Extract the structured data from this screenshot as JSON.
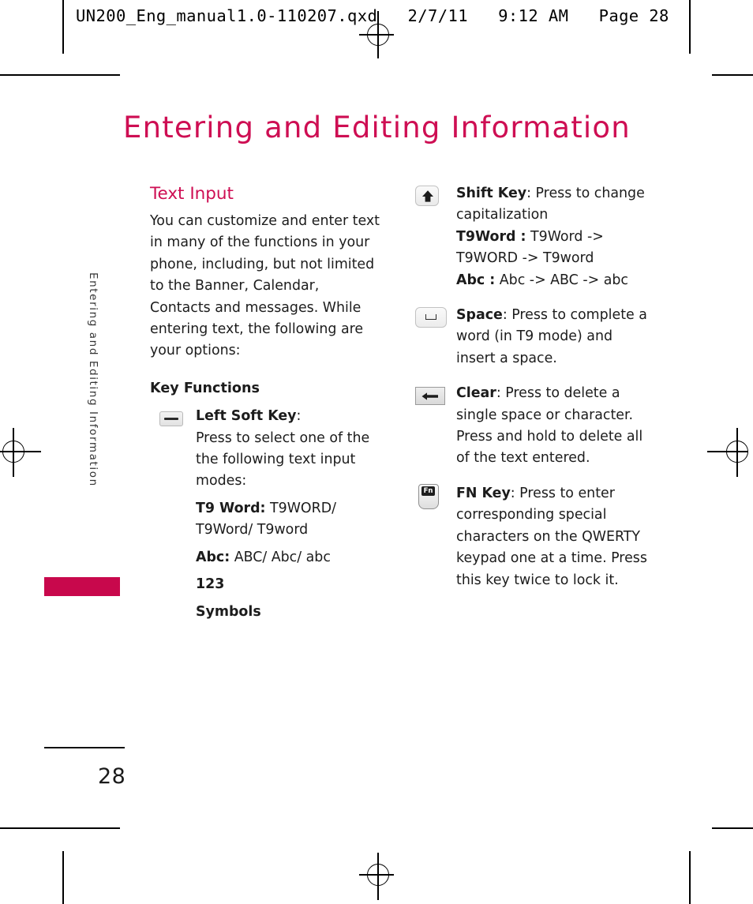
{
  "print_header": "UN200_Eng_manual1.0-110207.qxd   2/7/11   9:12 AM   Page 28",
  "chapter": {
    "title": "Entering and Editing Information",
    "running_head": "Entering and Editing Information",
    "accent_color": "#ce0e53",
    "tab_color": "#c8084c"
  },
  "page_number": "28",
  "left_column": {
    "section_heading": "Text Input",
    "intro_paragraph": "You can customize and enter text in many of the functions in your phone, including, but not limited to the Banner, Calendar, Contacts and messages. While entering text, the following are your options:",
    "key_functions_heading": "Key Functions",
    "soft_key": {
      "icon": "left-soft-key-icon",
      "label": "Left Soft Key",
      "label_suffix": ":",
      "description": "Press to select one of the the following text input modes:",
      "modes": [
        {
          "label": "T9 Word:",
          "value": " T9WORD/ T9Word/ T9word"
        },
        {
          "label": "Abc:",
          "value": " ABC/ Abc/ abc"
        },
        {
          "label": "123",
          "value": ""
        },
        {
          "label": "Symbols",
          "value": ""
        }
      ]
    }
  },
  "right_column": {
    "entries": [
      {
        "icon": "shift-key-icon",
        "label": "Shift Key",
        "label_suffix": ":",
        "description": " Press to change capitalization",
        "modes": [
          {
            "label": "T9Word :",
            "value": " T9Word -> T9WORD -> T9word"
          },
          {
            "label": "Abc :",
            "value": " Abc -> ABC -> abc"
          }
        ]
      },
      {
        "icon": "space-key-icon",
        "label": "Space",
        "label_suffix": ":",
        "description": " Press to complete a word (in T9 mode) and insert a space.",
        "modes": []
      },
      {
        "icon": "clear-key-icon",
        "label": "Clear",
        "label_suffix": ":",
        "description": " Press to delete a single space or character. Press and hold to delete all of the text entered.",
        "modes": []
      },
      {
        "icon": "fn-key-icon",
        "label": "FN Key",
        "label_suffix": ":",
        "description": " Press to enter corresponding special characters on the QWERTY keypad one at a time. Press this key twice to lock it.",
        "modes": [],
        "icon_caption": "Fn"
      }
    ]
  }
}
